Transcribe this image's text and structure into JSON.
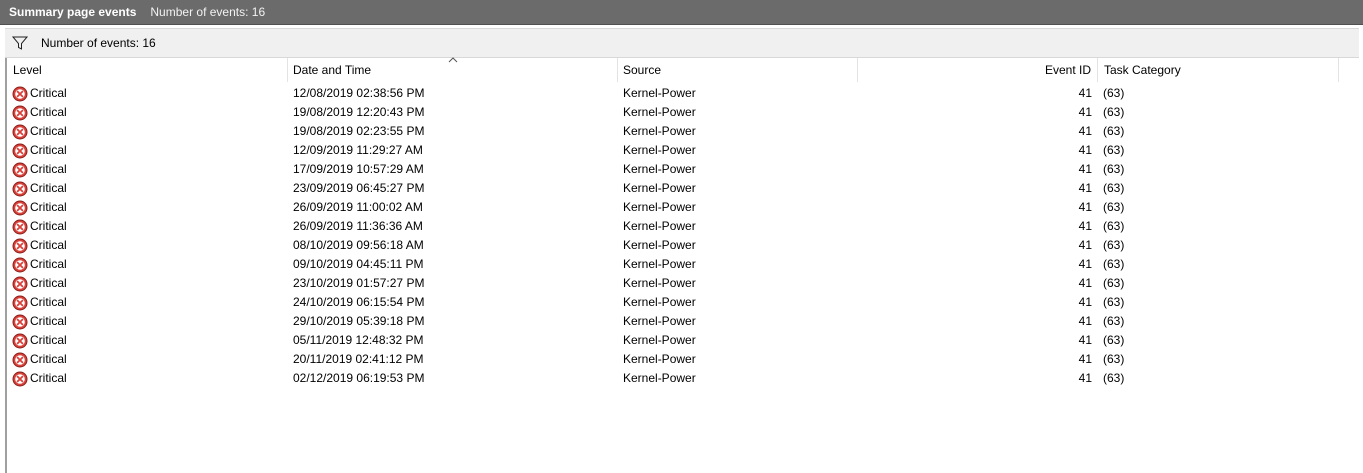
{
  "titlebar": {
    "title": "Summary page events",
    "count": "Number of events: 16"
  },
  "filterbar": {
    "icon": "filter-icon",
    "count": "Number of events: 16"
  },
  "columns": {
    "level": "Level",
    "datetime": "Date and Time",
    "source": "Source",
    "event_id": "Event ID",
    "task_category": "Task Category"
  },
  "sort": {
    "column": "datetime",
    "direction": "ascending",
    "icon": "sort-ascending-icon"
  },
  "level_icon": {
    "name": "critical-icon",
    "color": "#d9423a"
  },
  "rows": [
    {
      "level": "Critical",
      "datetime": "12/08/2019 02:38:56 PM",
      "source": "Kernel-Power",
      "event_id": "41",
      "task_category": "(63)"
    },
    {
      "level": "Critical",
      "datetime": "19/08/2019 12:20:43 PM",
      "source": "Kernel-Power",
      "event_id": "41",
      "task_category": "(63)"
    },
    {
      "level": "Critical",
      "datetime": "19/08/2019 02:23:55 PM",
      "source": "Kernel-Power",
      "event_id": "41",
      "task_category": "(63)"
    },
    {
      "level": "Critical",
      "datetime": "12/09/2019 11:29:27 AM",
      "source": "Kernel-Power",
      "event_id": "41",
      "task_category": "(63)"
    },
    {
      "level": "Critical",
      "datetime": "17/09/2019 10:57:29 AM",
      "source": "Kernel-Power",
      "event_id": "41",
      "task_category": "(63)"
    },
    {
      "level": "Critical",
      "datetime": "23/09/2019 06:45:27 PM",
      "source": "Kernel-Power",
      "event_id": "41",
      "task_category": "(63)"
    },
    {
      "level": "Critical",
      "datetime": "26/09/2019 11:00:02 AM",
      "source": "Kernel-Power",
      "event_id": "41",
      "task_category": "(63)"
    },
    {
      "level": "Critical",
      "datetime": "26/09/2019 11:36:36 AM",
      "source": "Kernel-Power",
      "event_id": "41",
      "task_category": "(63)"
    },
    {
      "level": "Critical",
      "datetime": "08/10/2019 09:56:18 AM",
      "source": "Kernel-Power",
      "event_id": "41",
      "task_category": "(63)"
    },
    {
      "level": "Critical",
      "datetime": "09/10/2019 04:45:11 PM",
      "source": "Kernel-Power",
      "event_id": "41",
      "task_category": "(63)"
    },
    {
      "level": "Critical",
      "datetime": "23/10/2019 01:57:27 PM",
      "source": "Kernel-Power",
      "event_id": "41",
      "task_category": "(63)"
    },
    {
      "level": "Critical",
      "datetime": "24/10/2019 06:15:54 PM",
      "source": "Kernel-Power",
      "event_id": "41",
      "task_category": "(63)"
    },
    {
      "level": "Critical",
      "datetime": "29/10/2019 05:39:18 PM",
      "source": "Kernel-Power",
      "event_id": "41",
      "task_category": "(63)"
    },
    {
      "level": "Critical",
      "datetime": "05/11/2019 12:48:32 PM",
      "source": "Kernel-Power",
      "event_id": "41",
      "task_category": "(63)"
    },
    {
      "level": "Critical",
      "datetime": "20/11/2019 02:41:12 PM",
      "source": "Kernel-Power",
      "event_id": "41",
      "task_category": "(63)"
    },
    {
      "level": "Critical",
      "datetime": "02/12/2019 06:19:53 PM",
      "source": "Kernel-Power",
      "event_id": "41",
      "task_category": "(63)"
    }
  ]
}
